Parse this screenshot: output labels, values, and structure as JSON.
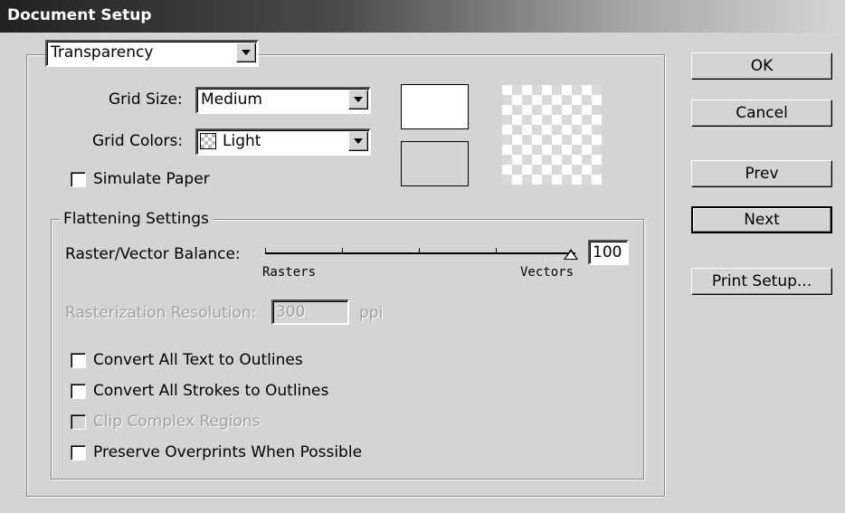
{
  "window": {
    "title": "Document Setup"
  },
  "section_dropdown": {
    "value": "Transparency"
  },
  "grid_size": {
    "label": "Grid Size:",
    "value": "Medium"
  },
  "grid_colors": {
    "label": "Grid Colors:",
    "value": "Light"
  },
  "simulate_paper": {
    "label": "Simulate Paper",
    "checked": false
  },
  "flattening": {
    "legend": "Flattening Settings",
    "balance_label": "Raster/Vector Balance:",
    "balance_value": "100",
    "slider_min_label": "Rasters",
    "slider_max_label": "Vectors",
    "resolution_label": "Rasterization Resolution:",
    "resolution_value": "300",
    "resolution_unit": "ppi",
    "options": [
      {
        "label": "Convert All Text to Outlines",
        "checked": false,
        "enabled": true
      },
      {
        "label": "Convert All Strokes to Outlines",
        "checked": false,
        "enabled": true
      },
      {
        "label": "Clip Complex Regions",
        "checked": false,
        "enabled": false
      },
      {
        "label": "Preserve Overprints When Possible",
        "checked": false,
        "enabled": true
      }
    ]
  },
  "buttons": {
    "ok": "OK",
    "cancel": "Cancel",
    "prev": "Prev",
    "next": "Next",
    "print_setup": "Print Setup..."
  },
  "colors": {
    "dialog_bg": "#d4d4d4",
    "swatch_top": "#ffffff",
    "swatch_bottom": "#d4d4d4"
  }
}
